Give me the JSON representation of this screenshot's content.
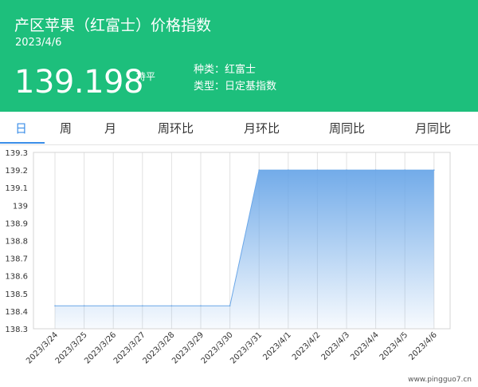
{
  "header": {
    "title": "产区苹果（红富士）价格指数",
    "date": "2023/4/6",
    "price": "139.198",
    "change": "持平",
    "variety_label": "种类：红富士",
    "type_label": "类型：日定基指数",
    "bg_color": "#1dbf7c"
  },
  "tabs": [
    {
      "label": "日",
      "active": true
    },
    {
      "label": "周",
      "active": false
    },
    {
      "label": "月",
      "active": false
    },
    {
      "label": "周环比",
      "active": false
    },
    {
      "label": "月环比",
      "active": false
    },
    {
      "label": "周同比",
      "active": false
    },
    {
      "label": "月同比",
      "active": false
    }
  ],
  "accent_color": "#3b8ee8",
  "watermark": "www.pingguo7.cn",
  "chart_data": {
    "type": "area",
    "x": [
      "2023/3/24",
      "2023/3/25",
      "2023/3/26",
      "2023/3/27",
      "2023/3/28",
      "2023/3/29",
      "2023/3/30",
      "2023/3/31",
      "2023/4/1",
      "2023/4/2",
      "2023/4/3",
      "2023/4/4",
      "2023/4/5",
      "2023/4/6"
    ],
    "series": [
      {
        "values": [
          138.43,
          138.43,
          138.43,
          138.43,
          138.43,
          138.43,
          138.43,
          139.2,
          139.2,
          139.2,
          139.2,
          139.2,
          139.2,
          139.2
        ]
      }
    ],
    "ylim": [
      138.3,
      139.3
    ],
    "yticks": [
      "139.3",
      "139.2",
      "139.1",
      "139",
      "138.9",
      "138.8",
      "138.7",
      "138.6",
      "138.5",
      "138.4",
      "138.3"
    ],
    "grid": true,
    "line_color": "#6ba7e8"
  }
}
